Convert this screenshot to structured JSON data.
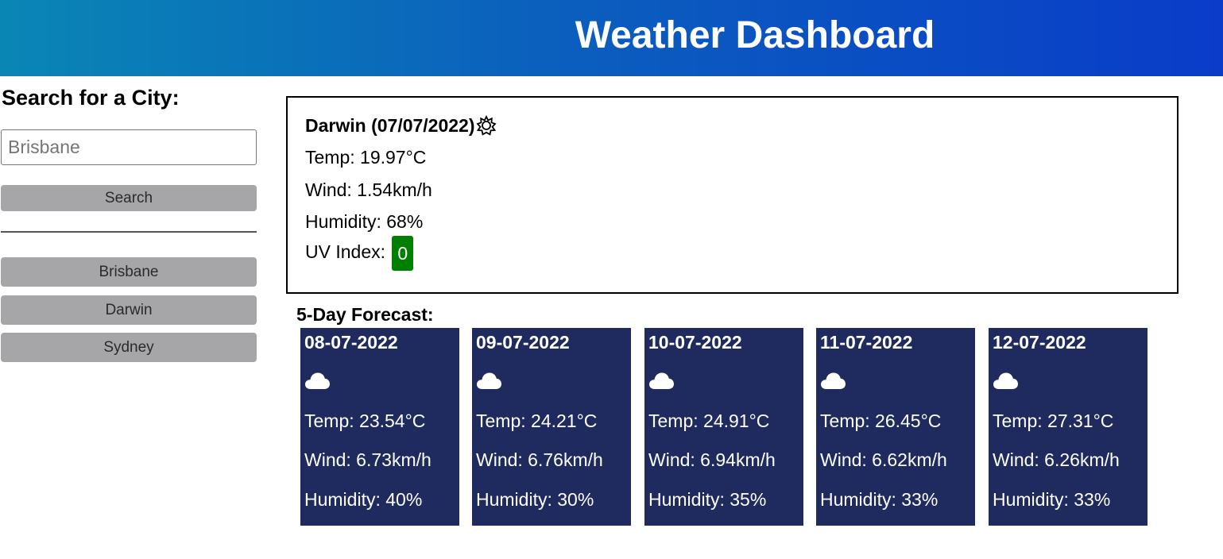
{
  "header": {
    "title": "Weather Dashboard"
  },
  "sidebar": {
    "heading": "Search for a City:",
    "search_placeholder": "Brisbane",
    "search_button": "Search",
    "history": [
      "Brisbane",
      "Darwin",
      "Sydney"
    ]
  },
  "current": {
    "title": "Darwin (07/07/2022)",
    "icon": "gear-like-sun-icon",
    "temp": "Temp: 19.97°C",
    "wind": "Wind: 1.54km/h",
    "humidity": "Humidity: 68%",
    "uv_label": "UV Index:",
    "uv_value": "0",
    "uv_color": "#008000"
  },
  "forecast": {
    "title": "5-Day Forecast:",
    "card_color": "#1f2a5e",
    "days": [
      {
        "date": "08-07-2022",
        "icon": "cloud-icon",
        "temp": "Temp: 23.54°C",
        "wind": "Wind: 6.73km/h",
        "humidity": "Humidity: 40%"
      },
      {
        "date": "09-07-2022",
        "icon": "cloud-icon",
        "temp": "Temp: 24.21°C",
        "wind": "Wind: 6.76km/h",
        "humidity": "Humidity: 30%"
      },
      {
        "date": "10-07-2022",
        "icon": "cloud-icon",
        "temp": "Temp: 24.91°C",
        "wind": "Wind: 6.94km/h",
        "humidity": "Humidity: 35%"
      },
      {
        "date": "11-07-2022",
        "icon": "cloud-icon",
        "temp": "Temp: 26.45°C",
        "wind": "Wind: 6.62km/h",
        "humidity": "Humidity: 33%"
      },
      {
        "date": "12-07-2022",
        "icon": "cloud-icon",
        "temp": "Temp: 27.31°C",
        "wind": "Wind: 6.26km/h",
        "humidity": "Humidity: 33%"
      }
    ]
  }
}
